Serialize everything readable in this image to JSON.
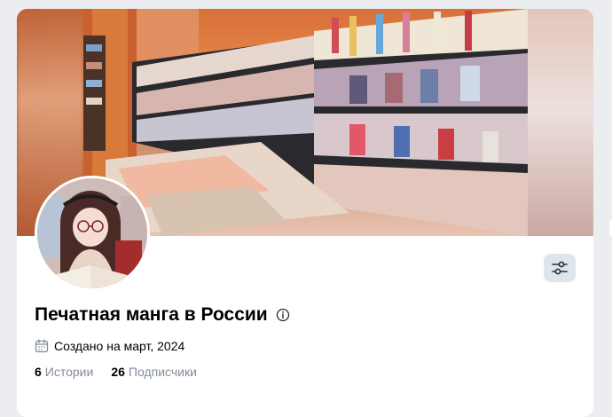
{
  "profile": {
    "title": "Печатная манга в России",
    "created_text": "Создано на март, 2024",
    "stats": {
      "stories_count": "6",
      "stories_label": "Истории",
      "subscribers_count": "26",
      "subscribers_label": "Подписчики"
    }
  },
  "icons": {
    "settings": "sliders-icon",
    "info": "info-icon",
    "calendar": "calendar-icon"
  },
  "colors": {
    "page_background": "#ebedf0",
    "card_background": "#ffffff",
    "settings_button_bg": "#dfe5ed",
    "muted_text": "#818c99",
    "primary_text": "#000000"
  }
}
